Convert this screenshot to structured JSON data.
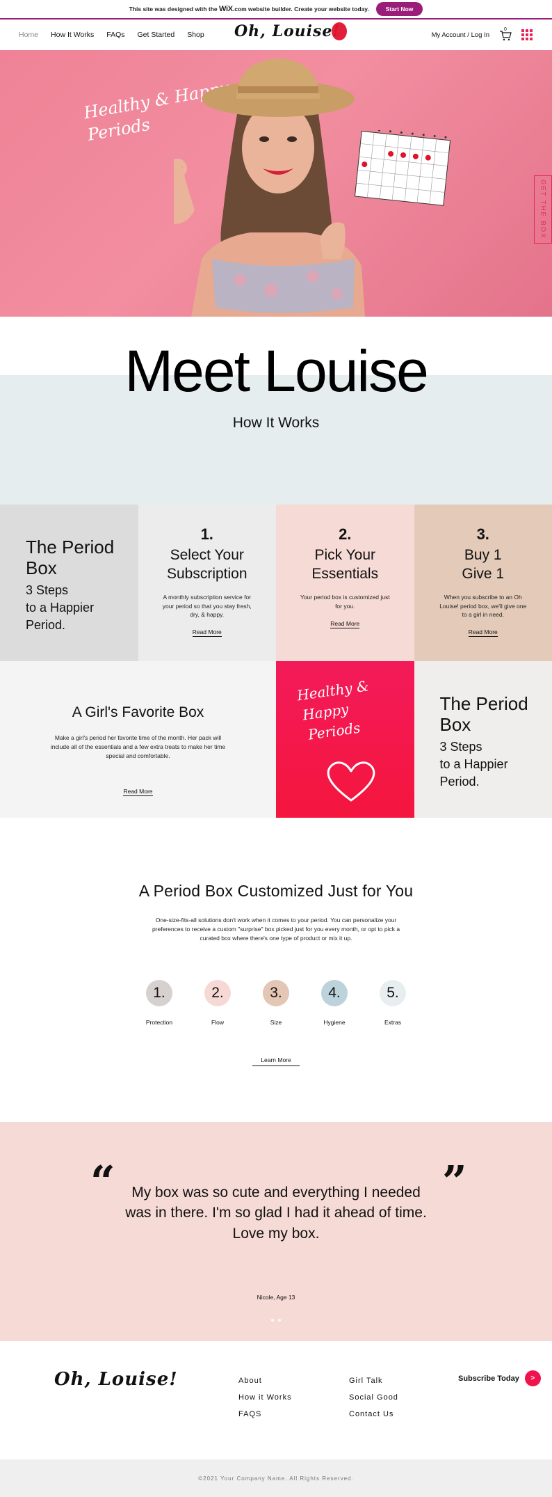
{
  "wix_banner": {
    "text_before": "This site was designed with the",
    "brand": "WiX",
    "brand_suffix": ".com website builder. Create your website today.",
    "button_label": "Start Now",
    "accent": "#9b1d7a"
  },
  "header": {
    "nav": [
      "Home",
      "How It Works",
      "FAQs",
      "Get Started",
      "Shop"
    ],
    "logo": "Oh, Louise!",
    "account": "My Account / Log In",
    "cart_count": "0",
    "menu_icon": "grid-dots-icon"
  },
  "hero": {
    "script_line1": "Healthy & Happy",
    "script_line2": "Periods",
    "side_button": "GET THE BOX",
    "calendar_header": "M T W T F S S"
  },
  "meet": {
    "title": "Meet Louise",
    "subtitle": "How It Works"
  },
  "steps": {
    "intro_title_1": "The Period",
    "intro_title_2": "Box",
    "intro_lines": [
      "3 Steps",
      "to a Happier",
      "Period."
    ],
    "items": [
      {
        "num": "1.",
        "title_1": "Select Your",
        "title_2": "Subscription",
        "desc": "A monthly subscription service for your period so that you stay fresh, dry, & happy.",
        "link": "Read More"
      },
      {
        "num": "2.",
        "title_1": "Pick Your",
        "title_2": "Essentials",
        "desc": "Your period box is customized just for you.",
        "link": "Read More"
      },
      {
        "num": "3.",
        "title_1": "Buy 1",
        "title_2": "Give 1",
        "desc": "When you subscribe to an Oh Louise! period box, we'll give one to a girl in need.",
        "link": "Read More"
      }
    ]
  },
  "favorite": {
    "title": "A Girl's Favorite Box",
    "desc": "Make a girl's period her favorite time of the month. Her pack will include all of the essentials and a few extra treats to make her time special and comfortable.",
    "link": "Read More",
    "script_lines": [
      "Healthy &",
      "Happy",
      "Periods"
    ]
  },
  "custom": {
    "title": "A Period Box Customized Just for You",
    "desc": "One-size-fits-all solutions don't work when it comes to your period. You can personalize your preferences to receive a custom \"surprise\" box picked just for you every month, or opt to pick a curated box where there's one type of product or mix it up.",
    "options": [
      {
        "num": "1.",
        "label": "Protection",
        "color": "#d6d0cf"
      },
      {
        "num": "2.",
        "label": "Flow",
        "color": "#f6d9d4"
      },
      {
        "num": "3.",
        "label": "Size",
        "color": "#e3c6b4"
      },
      {
        "num": "4.",
        "label": "Hygiene",
        "color": "#bcd3dc"
      },
      {
        "num": "5.",
        "label": "Extras",
        "color": "#e8eef0"
      }
    ],
    "button": "Learn More"
  },
  "testimonial": {
    "open_quote": "“",
    "close_quote": "”",
    "quote": "My box was so cute and everything I needed was in there. I'm so glad I had it ahead of time. Love my box.",
    "author": "Nicole, Age 13"
  },
  "footer": {
    "logo": "Oh, Louise!",
    "col1": [
      "About",
      "How it Works",
      "FAQS"
    ],
    "col2": [
      "Girl Talk",
      "Social Good",
      "Contact Us"
    ],
    "subscribe": "Subscribe Today",
    "subscribe_arrow": ">",
    "copyright": "©2021 Your Company Name. All Rights Reserved."
  },
  "colors": {
    "accent_pink": "#e8245a",
    "hero_bg": "#f28ea0",
    "band_blue": "#e6edef",
    "testimonial_bg": "#f6dad5"
  }
}
